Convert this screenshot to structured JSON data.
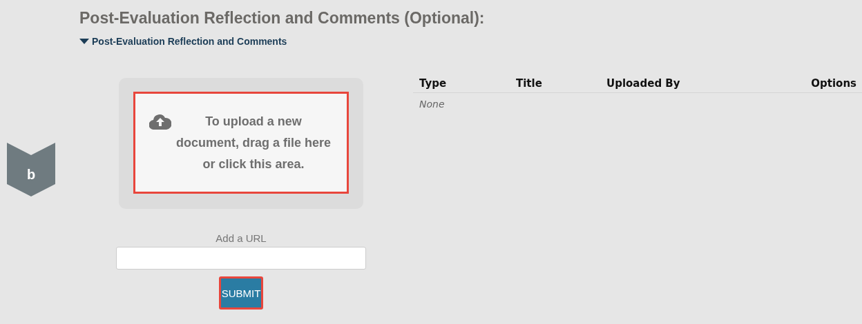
{
  "heading": "Post-Evaluation Reflection and Comments (Optional):",
  "section_toggle": {
    "label": "Post-Evaluation Reflection and Comments",
    "expanded": true
  },
  "badge": {
    "letter": "b"
  },
  "upload_area": {
    "text": "To upload a new document, drag a file here or click this area.",
    "highlighted": true
  },
  "url_field": {
    "label": "Add a URL"
  },
  "submit_button": {
    "label": "SUBMIT",
    "highlighted": true
  },
  "table": {
    "columns": [
      "Type",
      "Title",
      "Uploaded By",
      "Options"
    ],
    "empty_text": "None"
  }
}
